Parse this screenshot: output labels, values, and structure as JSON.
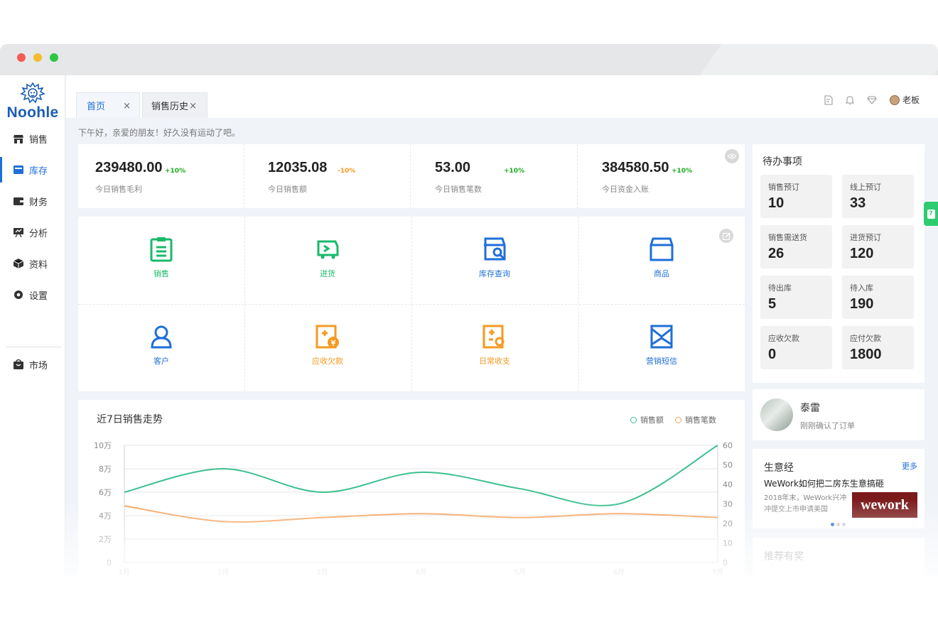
{
  "brand": {
    "name": "Noohle",
    "color": "#1a5db3"
  },
  "sidebar": {
    "items": [
      {
        "label": "销售",
        "icon": "shop-icon"
      },
      {
        "label": "库存",
        "icon": "inventory-icon",
        "active": true
      },
      {
        "label": "财务",
        "icon": "wallet-icon"
      },
      {
        "label": "分析",
        "icon": "analysis-icon"
      },
      {
        "label": "资料",
        "icon": "cube-icon"
      },
      {
        "label": "设置",
        "icon": "gear-icon"
      },
      {
        "label": "市场",
        "icon": "bag-icon"
      }
    ]
  },
  "tabs": [
    {
      "label": "首页",
      "close": "×"
    },
    {
      "label": "销售历史",
      "close": "×"
    }
  ],
  "header": {
    "user": "老板"
  },
  "greeting": "下午好，亲爱的朋友！好久没有运动了吧。",
  "stats": [
    {
      "value": "239480.00",
      "change": "+10%",
      "change_color": "#1aad19",
      "label": "今日销售毛利"
    },
    {
      "value": "12035.08",
      "change": "-10%",
      "change_color": "#f59a23",
      "label": "今日销售额"
    },
    {
      "value": "53.00",
      "change": "+10%",
      "change_color": "#1aad19",
      "label": "今日销售笔数"
    },
    {
      "value": "384580.50",
      "change": "+10%",
      "change_color": "#1aad19",
      "label": "今日资金入账"
    }
  ],
  "quick": [
    {
      "label": "销售",
      "icon": "clipboard-icon",
      "color": "#19b96a"
    },
    {
      "label": "进货",
      "icon": "truck-icon",
      "color": "#19b96a"
    },
    {
      "label": "库存查询",
      "icon": "store-search-icon",
      "color": "#1e6fd9"
    },
    {
      "label": "商品",
      "icon": "box-icon",
      "color": "#1e6fd9"
    },
    {
      "label": "客户",
      "icon": "person-icon",
      "color": "#1e6fd9"
    },
    {
      "label": "应收欠款",
      "icon": "receivable-icon",
      "color": "#f59a23"
    },
    {
      "label": "日常收支",
      "icon": "ledger-icon",
      "color": "#f59a23"
    },
    {
      "label": "营销短信",
      "icon": "sms-icon",
      "color": "#1e6fd9"
    }
  ],
  "chart_data": {
    "type": "line",
    "title": "近7日销售走势",
    "x": [
      "1月",
      "2月",
      "3月",
      "4月",
      "5月",
      "6月",
      "7月"
    ],
    "left_axis": {
      "ticks": [
        "0",
        "2万",
        "4万",
        "6万",
        "8万",
        "10万"
      ],
      "ylim": [
        0,
        100000
      ]
    },
    "right_axis": {
      "ticks": [
        "0",
        "10",
        "20",
        "30",
        "40",
        "50",
        "60"
      ],
      "ylim": [
        0,
        60
      ]
    },
    "series": [
      {
        "name": "销售额",
        "axis": "left",
        "color": "#3cc08e",
        "values": [
          60000,
          80000,
          60000,
          77000,
          63000,
          50000,
          100000
        ]
      },
      {
        "name": "销售笔数",
        "axis": "right",
        "color": "#f5a25d",
        "values": [
          29,
          21,
          23,
          25,
          23,
          25,
          23
        ]
      }
    ],
    "legend_position": "top-right",
    "grid": true
  },
  "todo": {
    "title": "待办事项",
    "items": [
      {
        "label": "销售预订",
        "value": "10"
      },
      {
        "label": "线上预订",
        "value": "33"
      },
      {
        "label": "销售需送货",
        "value": "26"
      },
      {
        "label": "进货预订",
        "value": "120"
      },
      {
        "label": "待出库",
        "value": "5"
      },
      {
        "label": "待入库",
        "value": "190"
      },
      {
        "label": "应收欠款",
        "value": "0"
      },
      {
        "label": "应付欠款",
        "value": "1800"
      }
    ]
  },
  "notice": {
    "name": "泰雷",
    "message": "刚刚确认了订单"
  },
  "business": {
    "title": "生意经",
    "more": "更多",
    "article_title": "WeWork如何把二房东生意搞砸",
    "article_excerpt": "2018年末，WeWork兴冲冲提交上市申请美国",
    "thumb_text": "wework"
  },
  "recommend": {
    "title": "推荐有奖"
  }
}
